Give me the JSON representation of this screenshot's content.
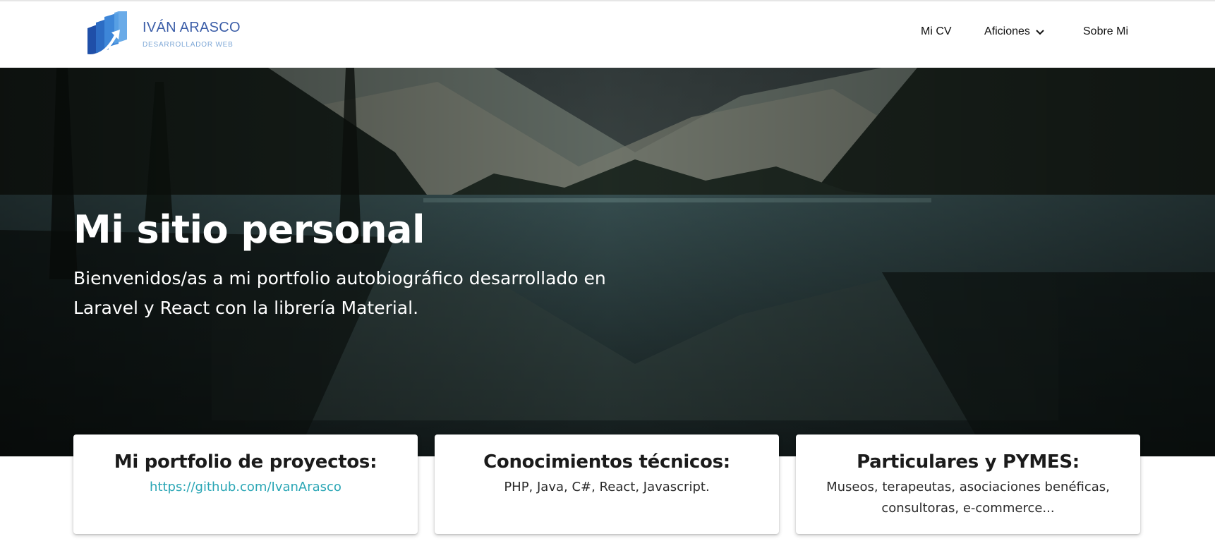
{
  "brand": {
    "name": "IVÁN ARASCO",
    "tagline": "DESARROLLADOR WEB",
    "logo_icon": "stacked-panels-arrow-logo",
    "colors": {
      "primary": "#3c5ea8",
      "secondary": "#7da7d6"
    }
  },
  "nav": {
    "items": [
      {
        "label": "Mi CV"
      },
      {
        "label": "Aficiones",
        "icon": "chevron-down-icon"
      },
      {
        "label": "Sobre Mi"
      }
    ]
  },
  "hero": {
    "title": "Mi sitio personal",
    "text": "Bienvenidos/as a mi portfolio autobiográfico desarrollado en Laravel y React con la librería Material.",
    "background": "mountain-lake-forest-image"
  },
  "cards": [
    {
      "title": "Mi portfolio de proyectos:",
      "link": "https://github.com/IvanArasco",
      "link_color": "#2aa6b5"
    },
    {
      "title": "Conocimientos técnicos:",
      "text": "PHP, Java, C#, React, Javascript."
    },
    {
      "title": "Particulares y PYMES:",
      "text": "Museos, terapeutas, asociaciones benéficas, consultoras, e-commerce..."
    }
  ]
}
